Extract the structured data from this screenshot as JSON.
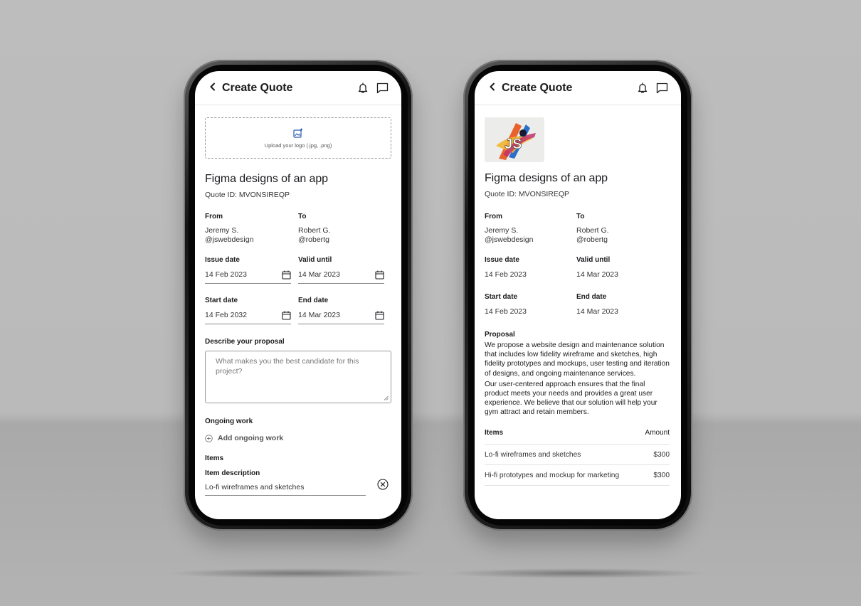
{
  "app": {
    "title": "Create Quote",
    "back_glyph": "<"
  },
  "icons": {
    "back": "chevron-left-icon",
    "notifications": "bell-icon",
    "messages": "chat-icon",
    "upload": "image-add-icon",
    "calendar": "calendar-icon",
    "add": "plus-circle-icon",
    "remove": "close-circle-icon",
    "resize": "resize-grip-icon"
  },
  "edit_screen": {
    "upload_hint": "Upload your logo (.jpg, .png)",
    "project_title": "Figma designs of an app",
    "quote_id": "Quote ID: MVONSIREQP",
    "from_label": "From",
    "from_name": "Jeremy S.",
    "from_handle": "@jswebdesign",
    "to_label": "To",
    "to_name": "Robert G.",
    "to_handle": "@robertg",
    "issue_label": "Issue date",
    "issue_value": "14 Feb 2023",
    "valid_label": "Valid until",
    "valid_value": "14 Mar 2023",
    "start_label": "Start date",
    "start_value": "14 Feb 2032",
    "end_label": "End date",
    "end_value": "14 Mar 2023",
    "proposal_label": "Describe your proposal",
    "proposal_placeholder": "What makes you the best candidate for this project?",
    "ongoing_label": "Ongoing work",
    "add_ongoing": "Add ongoing work",
    "items_label": "Items",
    "item_desc_label": "Item description",
    "item_desc_value": "Lo-fi wireframes and sketches"
  },
  "preview_screen": {
    "logo_text": "JS",
    "project_title": "Figma designs of an app",
    "quote_id": "Quote ID: MVONSIREQP",
    "from_label": "From",
    "from_name": "Jeremy S.",
    "from_handle": "@jswebdesign",
    "to_label": "To",
    "to_name": "Robert G.",
    "to_handle": "@robertg",
    "issue_label": "Issue date",
    "issue_value": "14 Feb 2023",
    "valid_label": "Valid until",
    "valid_value": "14 Mar 2023",
    "start_label": "Start date",
    "start_value": "14 Feb 2023",
    "end_label": "End date",
    "end_value": "14 Mar 2023",
    "proposal_label": "Proposal",
    "proposal_p1": "We propose a website design and maintenance solution that includes low fidelity wireframe and sketches, high fidelity prototypes and mockups, user testing and iteration of designs, and ongoing maintenance services.",
    "proposal_p2": "Our user-centered approach ensures that the final product meets your needs and provides a great user experience. We believe that our solution will help your gym attract and retain members.",
    "items_header": "Items",
    "amount_header": "Amount",
    "items": [
      {
        "description": "Lo-fi wireframes and sketches",
        "amount": "$300"
      },
      {
        "description": "Hi-fi prototypes and mockup for marketing",
        "amount": "$300"
      }
    ]
  },
  "colors": {
    "background": "#bdbdbd",
    "text": "#1b1b1f",
    "muted": "#777777",
    "border": "#9a9a9a"
  }
}
